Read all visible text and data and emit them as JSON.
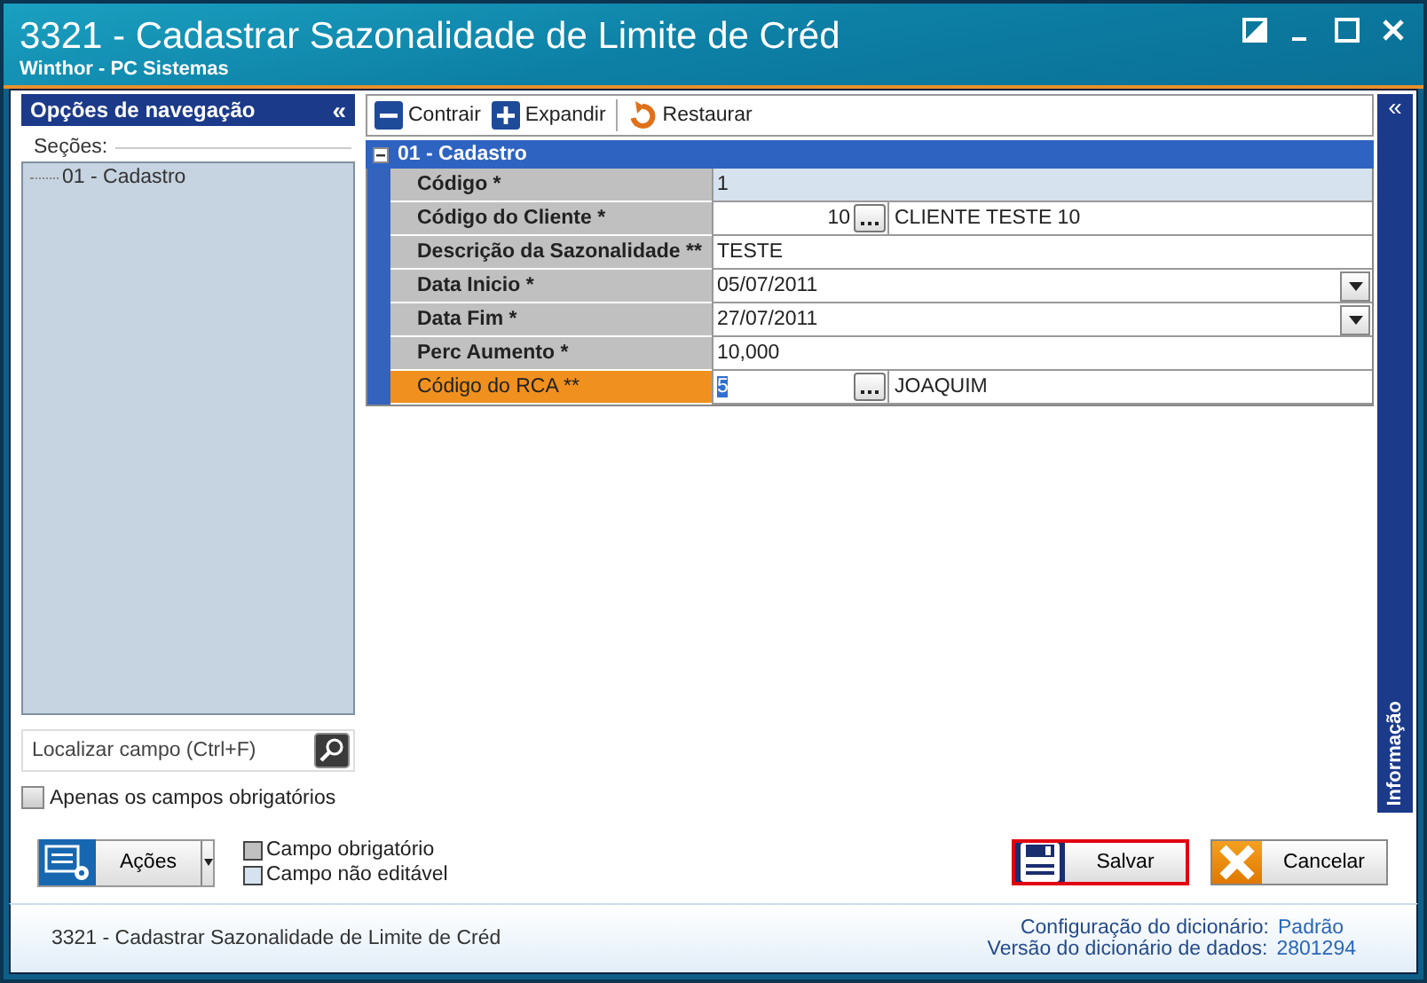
{
  "window": {
    "title": "3321 - Cadastrar Sazonalidade de Limite de Créd",
    "subtitle": "Winthor - PC Sistemas"
  },
  "nav": {
    "title": "Opções de navegação",
    "collapse": "«",
    "sections_label": "Seções:",
    "tree": [
      {
        "label": "01 - Cadastro",
        "selected": false
      }
    ],
    "search": {
      "placeholder": "Localizar campo (Ctrl+F)"
    },
    "only_required": {
      "label": "Apenas os campos obrigatórios",
      "checked": false
    }
  },
  "toolbar": [
    {
      "kind": "collapse",
      "label": "Contrair"
    },
    {
      "kind": "expand",
      "label": "Expandir"
    },
    {
      "kind": "restore",
      "label": "Restaurar"
    }
  ],
  "side_panel": {
    "collapse": "«",
    "label": "Informação"
  },
  "group": {
    "title": "01 - Cadastro",
    "expanded": true,
    "fields": [
      {
        "kind": "text",
        "label": "Código *",
        "value": "1",
        "editable": false,
        "focused": false
      },
      {
        "kind": "lookup",
        "label": "Código do Cliente *",
        "value": "10",
        "description": "CLIENTE TESTE 10",
        "editable": true,
        "focused": false
      },
      {
        "kind": "text",
        "label": "Descrição da Sazonalidade **",
        "value": "TESTE",
        "editable": true,
        "focused": false
      },
      {
        "kind": "date",
        "label": "Data Inicio *",
        "value": "05/07/2011",
        "editable": true,
        "focused": false
      },
      {
        "kind": "date",
        "label": "Data Fim *",
        "value": "27/07/2011",
        "editable": true,
        "focused": false
      },
      {
        "kind": "text",
        "label": "Perc Aumento *",
        "value": "10,000",
        "editable": true,
        "focused": false
      },
      {
        "kind": "lookup",
        "label": "Código do RCA **",
        "value": "5",
        "description": "JOAQUIM",
        "editable": true,
        "focused": true
      }
    ]
  },
  "actions_button": "Ações",
  "legend": [
    {
      "label": "Campo obrigatório",
      "color": "#c0c0c0"
    },
    {
      "label": "Campo não editável",
      "color": "#d6e2ee"
    }
  ],
  "buttons": [
    {
      "kind": "save",
      "label": "Salvar",
      "selected": true
    },
    {
      "kind": "cancel",
      "label": "Cancelar",
      "selected": false
    }
  ],
  "status_bar": {
    "left": "3321 - Cadastrar Sazonalidade de Limite de Créd",
    "lines": [
      {
        "label": "Configuração do dicionário:",
        "value": "Padrão"
      },
      {
        "label": "Versão do dicionário de dados:",
        "value": "2801294"
      }
    ]
  }
}
